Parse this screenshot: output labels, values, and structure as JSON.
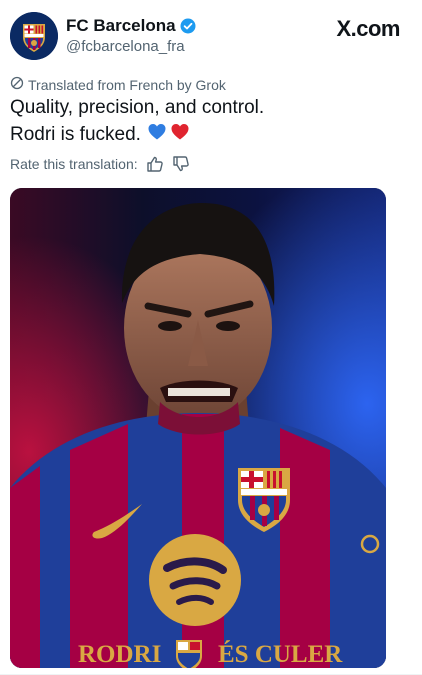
{
  "account": {
    "name": "FC Barcelona",
    "handle": "@fcbarcelona_fra",
    "verified": true,
    "avatar_icon": "fc-barcelona-crest-icon"
  },
  "site": {
    "brand": "X.com"
  },
  "translation": {
    "label": "Translated from French by Grok",
    "rate_label": "Rate this translation:"
  },
  "post": {
    "line1": "Quality, precision, and control.",
    "line2": "Rodri is fucked.",
    "emojis": [
      "blue-heart",
      "red-heart"
    ]
  },
  "media": {
    "caption_left": "RODRI",
    "caption_right": "ÉS CULER"
  },
  "colors": {
    "barca_blue": "#1f3f9a",
    "barca_red": "#a50044",
    "barca_gold": "#d9a843",
    "verified_blue": "#1d9bf0"
  }
}
